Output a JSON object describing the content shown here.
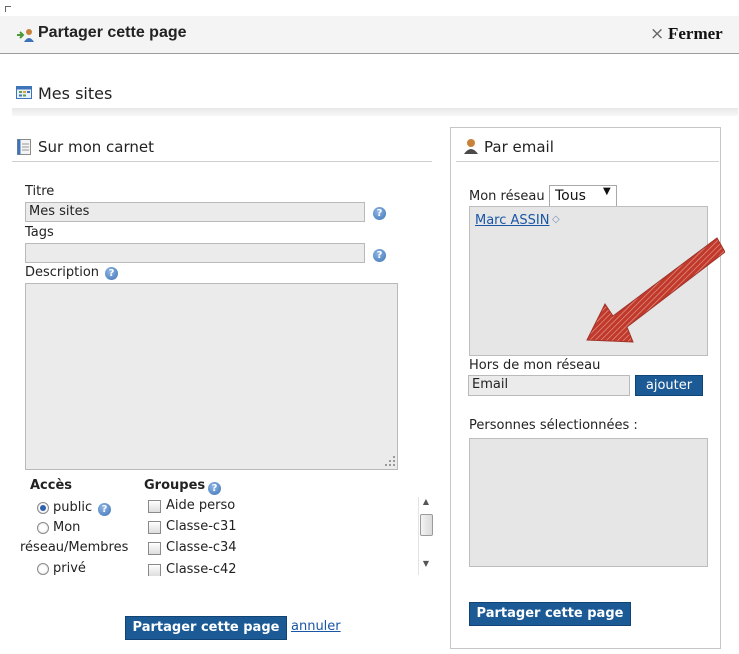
{
  "header": {
    "title": "Partager cette page",
    "close_label": "Fermer",
    "close_icon": "×"
  },
  "page": {
    "title": "Mes sites"
  },
  "carnet": {
    "title": "Sur mon carnet",
    "titre_label": "Titre",
    "titre_value": "Mes sites",
    "tags_label": "Tags",
    "tags_value": "",
    "description_label": "Description",
    "help_glyph": "?",
    "acces": {
      "label": "Accès",
      "options": [
        {
          "label": "public",
          "checked": true
        },
        {
          "label": "Mon",
          "label2": "réseau/Membres",
          "checked": false
        },
        {
          "label": "privé",
          "checked": false
        }
      ]
    },
    "groupes": {
      "label": "Groupes",
      "items": [
        "Aide perso",
        "Classe-c31",
        "Classe-c34",
        "Classe-c42"
      ]
    },
    "submit_label": "Partager cette page",
    "cancel_label": "annuler"
  },
  "email_panel": {
    "title": "Par email",
    "network_label": "Mon réseau",
    "network_select": "Tous",
    "contacts": [
      "Marc ASSIN"
    ],
    "outside_label": "Hors de mon réseau",
    "email_value": "Email",
    "add_label": "ajouter",
    "selected_label": "Personnes sélectionnées :",
    "submit_label": "Partager cette page"
  },
  "colors": {
    "button_blue": "#1c5a96",
    "link_blue": "#1a56a6",
    "annotation_red": "#c0392b"
  }
}
